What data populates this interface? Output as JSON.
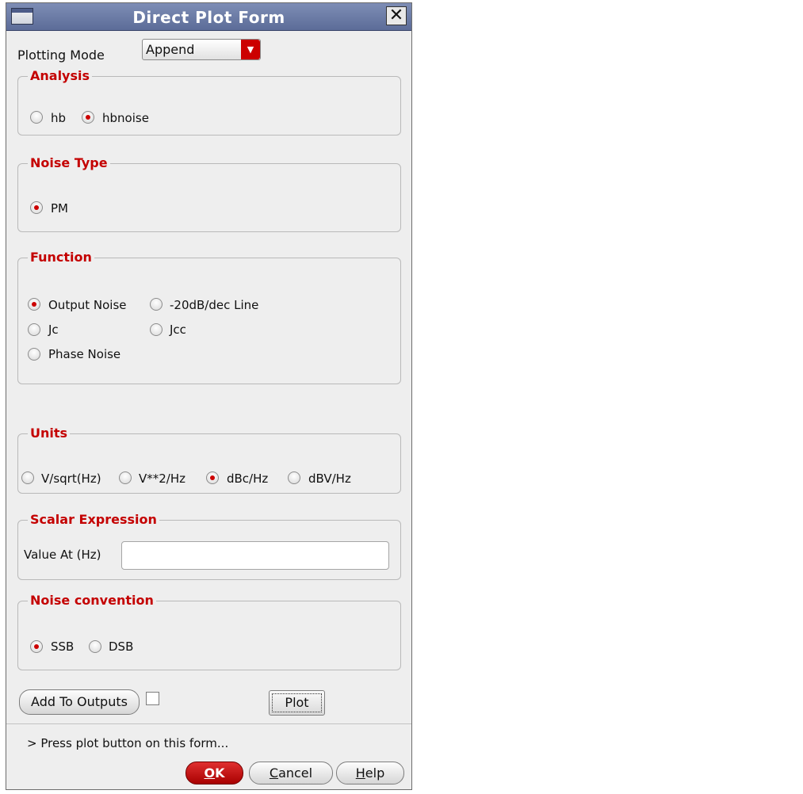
{
  "window": {
    "title": "Direct Plot Form"
  },
  "plotting_mode": {
    "label": "Plotting Mode",
    "value": "Append"
  },
  "analysis": {
    "title": "Analysis",
    "options": [
      {
        "label": "hb",
        "selected": false
      },
      {
        "label": "hbnoise",
        "selected": true
      }
    ]
  },
  "noise_type": {
    "title": "Noise Type",
    "options": [
      {
        "label": "PM",
        "selected": true
      }
    ]
  },
  "function": {
    "title": "Function",
    "options": [
      {
        "label": "Output Noise",
        "selected": true
      },
      {
        "label": "-20dB/dec Line",
        "selected": false
      },
      {
        "label": "Jc",
        "selected": false
      },
      {
        "label": "Jcc",
        "selected": false
      },
      {
        "label": "Phase Noise",
        "selected": false
      }
    ]
  },
  "units": {
    "title": "Units",
    "options": [
      {
        "label": "V/sqrt(Hz)",
        "selected": false
      },
      {
        "label": "V**2/Hz",
        "selected": false
      },
      {
        "label": "dBc/Hz",
        "selected": true
      },
      {
        "label": "dBV/Hz",
        "selected": false
      }
    ]
  },
  "scalar_expression": {
    "title": "Scalar Expression",
    "value_label": "Value At (Hz)",
    "value": ""
  },
  "noise_convention": {
    "title": "Noise convention",
    "options": [
      {
        "label": "SSB",
        "selected": true
      },
      {
        "label": "DSB",
        "selected": false
      }
    ]
  },
  "actions": {
    "add_to_outputs": "Add To Outputs",
    "add_to_outputs_checked": false,
    "plot": "Plot"
  },
  "status": "> Press plot button on this form...",
  "buttons": {
    "ok_mnemonic": "O",
    "ok_rest": "K",
    "cancel_mnemonic": "C",
    "cancel_rest": "ancel",
    "help_mnemonic": "H",
    "help_rest": "elp"
  },
  "colors": {
    "accent": "#cc0000",
    "titlebar": "#6b7aa5",
    "group_title": "#c40000"
  }
}
